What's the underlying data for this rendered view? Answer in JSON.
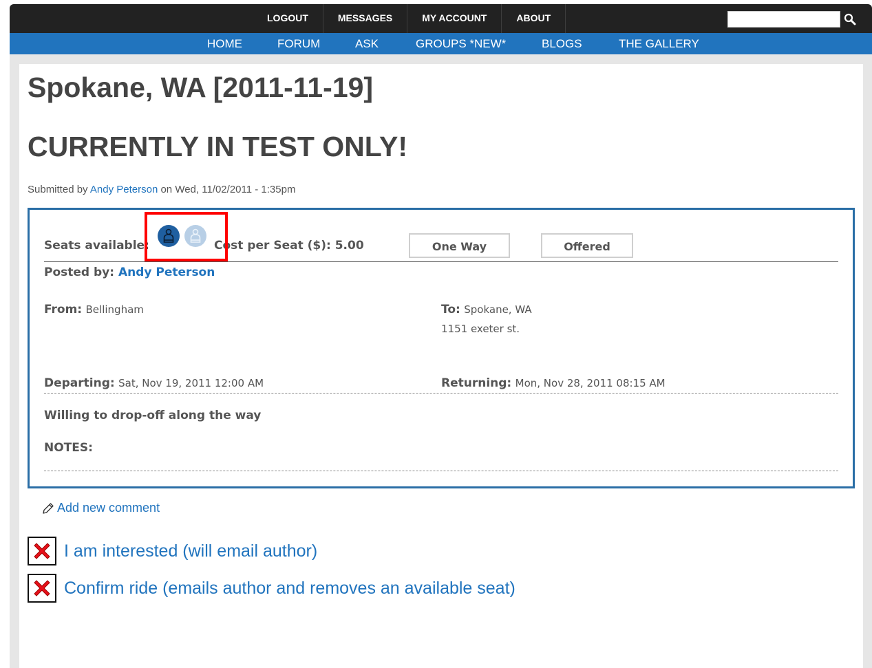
{
  "topnav": {
    "items": [
      "LOGOUT",
      "MESSAGES",
      "MY ACCOUNT",
      "ABOUT"
    ],
    "search_icon": "magnifier-icon"
  },
  "mainnav": {
    "items": [
      "HOME",
      "FORUM",
      "ASK",
      "GROUPS *NEW*",
      "BLOGS",
      "THE GALLERY"
    ]
  },
  "page": {
    "title": "Spokane, WA [2011-11-19]",
    "subtitle": "CURRENTLY IN TEST ONLY!",
    "submitted_prefix": "Submitted by",
    "submitted_author": "Andy Peterson",
    "submitted_suffix": "on Wed, 11/02/2011 - 1:35pm"
  },
  "ride": {
    "seats_label": "Seats available:",
    "seat_icons": [
      "seat-taken-icon",
      "seat-available-icon"
    ],
    "cost_label": "Cost per Seat ($):",
    "cost_value": "5.00",
    "trip_type": "One Way",
    "offer_type": "Offered",
    "posted_label": "Posted by:",
    "posted_author": "Andy Peterson",
    "from_label": "From:",
    "from_value": "Bellingham",
    "to_label": "To:",
    "to_value": "Spokane, WA",
    "to_address": "1151 exeter st.",
    "departing_label": "Departing:",
    "departing_value": "Sat, Nov 19, 2011 12:00 AM",
    "returning_label": "Returning:",
    "returning_value": "Mon, Nov 28, 2011 08:15 AM",
    "dropoff_note": "Willing to drop-off along the way",
    "notes_label": "NOTES:"
  },
  "actions": {
    "add_comment": "Add new comment",
    "interested": "I am interested (will email author)",
    "confirm": "Confirm ride (emails author and removes an available seat)"
  },
  "colors": {
    "topbar": "#222222",
    "mainnav": "#2174be",
    "link": "#2174be",
    "box_border": "#2a6ea6",
    "highlight": "#ff0000",
    "seat_taken": "#1f5fa0",
    "seat_available": "#b8cfe6"
  }
}
